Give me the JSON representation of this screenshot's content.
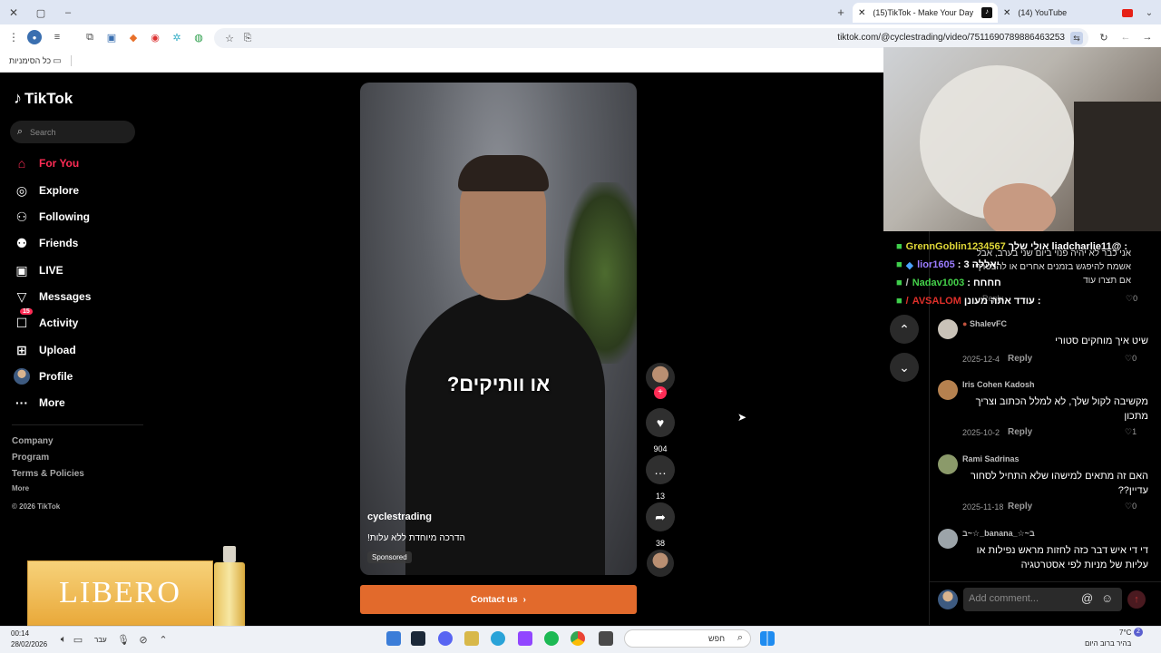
{
  "tabs": [
    {
      "label": "(15)TikTok - Make Your Day",
      "active": true
    },
    {
      "label": "(14) YouTube",
      "active": false
    }
  ],
  "address": {
    "url": "tiktok.com/@cyclestrading/video/7511690789886463253"
  },
  "bookmarks": {
    "all_label": "כל הסימניות"
  },
  "brand": {
    "name": "TikTok"
  },
  "search": {
    "placeholder": "Search"
  },
  "nav": [
    {
      "label": "For You",
      "icon": "home-icon",
      "active": true
    },
    {
      "label": "Explore",
      "icon": "compass-icon"
    },
    {
      "label": "Following",
      "icon": "following-icon"
    },
    {
      "label": "Friends",
      "icon": "friends-icon"
    },
    {
      "label": "LIVE",
      "icon": "live-icon"
    },
    {
      "label": "Messages",
      "icon": "messages-icon"
    },
    {
      "label": "Activity",
      "icon": "activity-icon",
      "badge": "15"
    },
    {
      "label": "Upload",
      "icon": "upload-icon"
    },
    {
      "label": "Profile",
      "icon": "avatar"
    },
    {
      "label": "More",
      "icon": "more-icon"
    }
  ],
  "footer": {
    "company": "Company",
    "program": "Program",
    "terms": "Terms & Policies",
    "more": "More",
    "copyright": "© 2026 TikTok"
  },
  "video": {
    "caption_overlay": "או וותיקים?",
    "author": "cyclestrading",
    "description": "הדרכה מיוחדת ללא עלות!",
    "sponsored": "Sponsored",
    "cta": "Contact us"
  },
  "actions": {
    "likes": "904",
    "comments": "13",
    "shares": "38"
  },
  "chat": [
    {
      "user": "GrennGoblin1234567",
      "text": ": @liadcharlie11 אולי שלך",
      "color": "#e0d838"
    },
    {
      "user": "lior1605",
      "text": ": יאללה 3",
      "color": "#9b7cff"
    },
    {
      "user": "Nadav1003",
      "text": ": חחחח",
      "color": "#44d24a"
    },
    {
      "user": "AVSALOM",
      "text": ": עודד אתה מעונן",
      "color": "#e0302a"
    }
  ],
  "top_comment_partial": {
    "text": "אני כבר לא יהיה פנוי ביום שני בערב, אבל אשמח להיפגש בזמנים אחרים או להצטרף אם תצרו עוד",
    "date": "",
    "reply": "Reply",
    "likes": "0"
  },
  "comments": [
    {
      "name": "ShalevFC",
      "text": "שיט איך מוחקים סטורי",
      "date": "2025-12-4",
      "reply": "Reply",
      "likes": "0",
      "avatar_color": "#c9c2b8"
    },
    {
      "name": "Iris Cohen Kadosh",
      "text": "מקשיבה לקול שלך, לא למלל הכתוב וצריך מתכון",
      "date": "2025-10-2",
      "reply": "Reply",
      "likes": "1",
      "avatar_color": "#b5814f"
    },
    {
      "name": "Rami Sadrinas",
      "text": "האם זה מתאים למישהו שלא התחיל לסחור עדיין??",
      "date": "2025-11-18",
      "reply": "Reply",
      "likes": "0",
      "avatar_color": "#8b9a6a"
    },
    {
      "name": "ב~☆_banana_☆~ב",
      "text": "די די איש דבר כזה לחזות מראש נפילות או עליות של מניות לפי אסטרטגיה",
      "date": "",
      "reply": "",
      "likes": "",
      "avatar_color": "#9ca4a9"
    }
  ],
  "add_comment": {
    "placeholder": "Add comment..."
  },
  "ad": {
    "brand": "LIBERO"
  },
  "taskbar": {
    "time": "00:14",
    "date": "28/02/2026",
    "lang": "עבר",
    "search": "חפש",
    "weather_temp": "7°C",
    "weather_text": "בהיר ברוב היום",
    "notif_count": "2"
  }
}
